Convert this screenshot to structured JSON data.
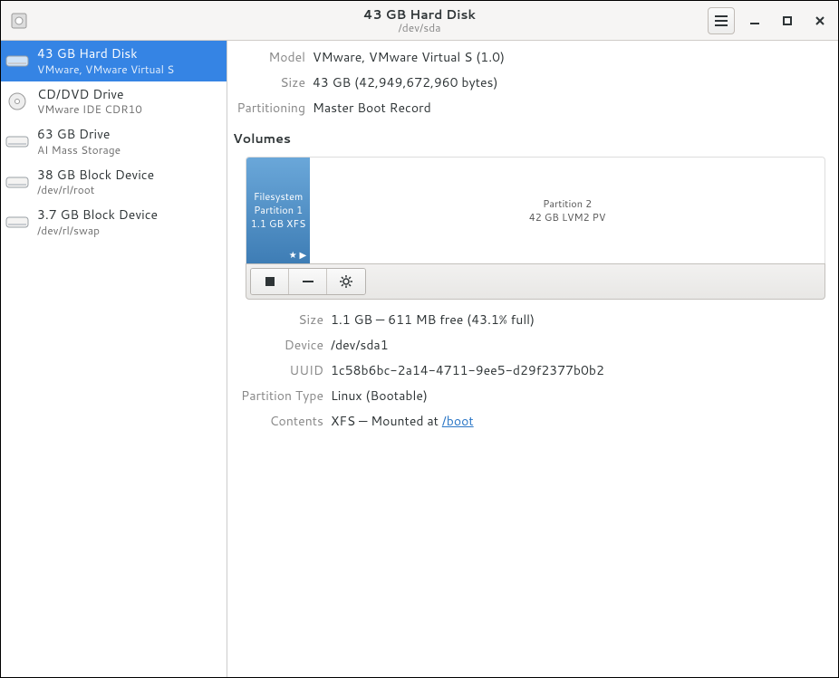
{
  "header": {
    "title": "43 GB Hard Disk",
    "subtitle": "/dev/sda"
  },
  "sidebar": {
    "items": [
      {
        "title": "43 GB Hard Disk",
        "sub": "VMware, VMware Virtual S",
        "icon": "hdd",
        "selected": true
      },
      {
        "title": "CD/DVD Drive",
        "sub": "VMware IDE CDR10",
        "icon": "cd",
        "selected": false
      },
      {
        "title": "63 GB Drive",
        "sub": "AI Mass Storage",
        "icon": "hdd",
        "selected": false
      },
      {
        "title": "38 GB Block Device",
        "sub": "/dev/rl/root",
        "icon": "hdd",
        "selected": false
      },
      {
        "title": "3.7 GB Block Device",
        "sub": "/dev/rl/swap",
        "icon": "hdd",
        "selected": false
      }
    ]
  },
  "disk": {
    "model_label": "Model",
    "model": "VMware, VMware Virtual S (1.0)",
    "size_label": "Size",
    "size": "43 GB (42,949,672,960 bytes)",
    "part_label": "Partitioning",
    "part": "Master Boot Record"
  },
  "volumes": {
    "heading": "Volumes",
    "blocks": [
      {
        "lines": [
          "Filesystem",
          "Partition 1",
          "1.1 GB XFS"
        ],
        "widthPct": 11,
        "selected": true,
        "badges": "★ ▶"
      },
      {
        "lines": [
          "Partition 2",
          "42 GB LVM2 PV"
        ],
        "widthPct": 89,
        "selected": false,
        "badges": ""
      }
    ]
  },
  "partition": {
    "size_label": "Size",
    "size": "1.1 GB — 611 MB free (43.1% full)",
    "device_label": "Device",
    "device": "/dev/sda1",
    "uuid_label": "UUID",
    "uuid": "1c58b6bc-2a14-4711-9ee5-d29f2377b0b2",
    "type_label": "Partition Type",
    "type": "Linux (Bootable)",
    "contents_label": "Contents",
    "contents_prefix": "XFS — Mounted at ",
    "contents_link": "/boot"
  }
}
